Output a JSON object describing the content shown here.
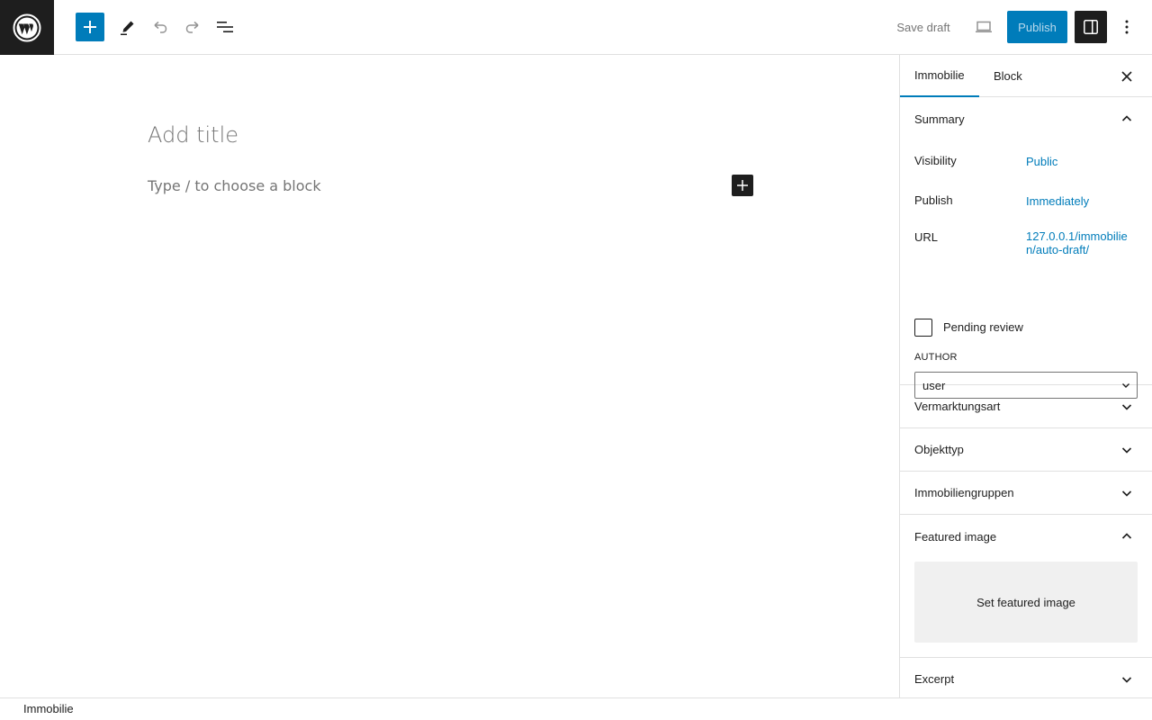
{
  "toolbar": {
    "save_draft_label": "Save draft",
    "publish_label": "Publish"
  },
  "editor": {
    "title_placeholder": "Add title",
    "block_placeholder": "Type / to choose a block"
  },
  "sidebar": {
    "tabs": [
      {
        "label": "Immobilie",
        "active": true
      },
      {
        "label": "Block",
        "active": false
      }
    ],
    "summary": {
      "title": "Summary",
      "visibility_label": "Visibility",
      "visibility_value": "Public",
      "publish_label": "Publish",
      "publish_value": "Immediately",
      "url_label": "URL",
      "url_value": "127.0.0.1/immobilien/auto-draft/",
      "pending_review_label": "Pending review",
      "author_label": "AUTHOR",
      "author_value": "user"
    },
    "panels": [
      {
        "title": "Vermarktungsart"
      },
      {
        "title": "Objekttyp"
      },
      {
        "title": "Immobiliengruppen"
      }
    ],
    "featured_image": {
      "title": "Featured image",
      "button_label": "Set featured image"
    },
    "excerpt": {
      "title": "Excerpt"
    }
  },
  "footer": {
    "breadcrumb": "Immobilie"
  },
  "colors": {
    "accent": "#007cba",
    "dark": "#1e1e1e",
    "border": "#e0e0e0",
    "muted": "#757575"
  },
  "icons": {
    "logo": "wordpress-logo-icon",
    "inserter": "plus-icon",
    "edit": "pencil-icon",
    "undo": "undo-icon",
    "redo": "redo-icon",
    "list_view": "list-view-icon",
    "preview": "desktop-preview-icon",
    "settings": "sidebar-settings-icon",
    "options": "more-vertical-icon",
    "close": "close-icon",
    "chevron_up": "chevron-up-icon",
    "chevron_down": "chevron-down-icon"
  }
}
